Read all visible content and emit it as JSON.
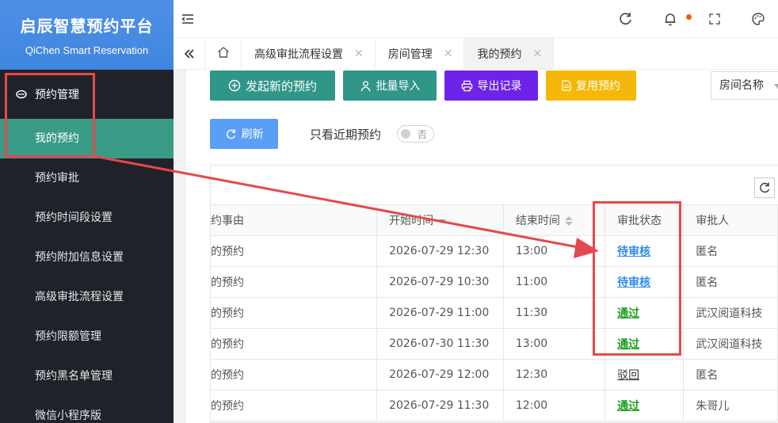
{
  "brand": {
    "title": "启辰智慧预约平台",
    "subtitle": "QiChen Smart Reservation"
  },
  "sidebar": {
    "group": "预约管理",
    "items": [
      {
        "label": "我的预约",
        "active": true
      },
      {
        "label": "预约审批"
      },
      {
        "label": "预约时间段设置"
      },
      {
        "label": "预约附加信息设置"
      },
      {
        "label": "高级审批流程设置"
      },
      {
        "label": "预约限额管理"
      },
      {
        "label": "预约黑名单管理"
      },
      {
        "label": "微信小程序版"
      }
    ]
  },
  "topbar": {
    "icons": [
      "collapse-menu-icon",
      "refresh-icon",
      "bell-icon",
      "fullscreen-icon",
      "theme-icon"
    ]
  },
  "tabs": [
    {
      "label": "高级审批流程设置"
    },
    {
      "label": "房间管理"
    },
    {
      "label": "我的预约",
      "active": true
    }
  ],
  "toolbar": {
    "new_label": "发起新的预约",
    "import_label": "批量导入",
    "export_label": "导出记录",
    "reuse_label": "复用预约",
    "refresh_label": "刷新",
    "recent_label": "只看近期预约",
    "switch_text": "否",
    "select_value": "房间名称"
  },
  "table": {
    "headers": [
      "约事由",
      "开始时间",
      "结束时间",
      "审批状态",
      "审批人"
    ],
    "rows": [
      {
        "reason": "的预约",
        "start": "2026-07-29 12:30",
        "end": "13:00",
        "status": "待审核",
        "approver": "匿名"
      },
      {
        "reason": "的预约",
        "start": "2026-07-29 10:30",
        "end": "11:00",
        "status": "待审核",
        "approver": "匿名"
      },
      {
        "reason": "的预约",
        "start": "2026-07-29 11:00",
        "end": "11:30",
        "status": "通过",
        "approver": "武汉阅道科技"
      },
      {
        "reason": "的预约",
        "start": "2026-07-30 11:30",
        "end": "13:00",
        "status": "通过",
        "approver": "武汉阅道科技"
      },
      {
        "reason": "的预约",
        "start": "2026-07-29 12:00",
        "end": "12:30",
        "status": "驳回",
        "approver": "匿名"
      },
      {
        "reason": "的预约",
        "start": "2026-07-29 11:30",
        "end": "12:00",
        "status": "通过",
        "approver": "朱哥儿"
      }
    ]
  },
  "colors": {
    "sidebar_bg": "#20222a",
    "brand_bg": "#4a90e2",
    "active_item": "#3a9b86",
    "primary": "#2f9688",
    "purple": "#6d23e8",
    "yellow": "#f5b80a",
    "blue": "#5a9ff5",
    "annotation": "#e5484d"
  }
}
